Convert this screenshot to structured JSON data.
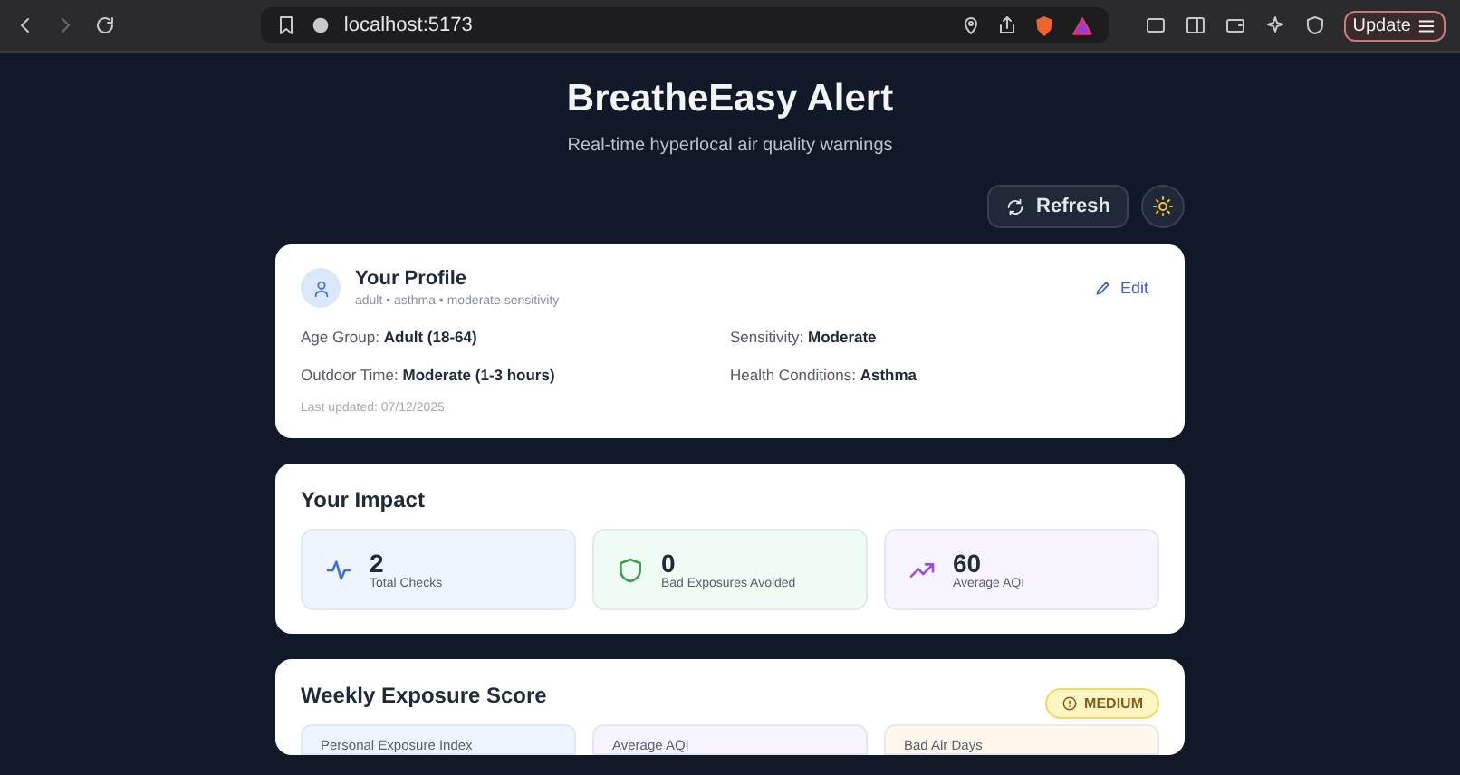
{
  "browser": {
    "url": "localhost:5173",
    "update_button": "Update"
  },
  "header": {
    "title": "BreatheEasy Alert",
    "subtitle": "Real-time hyperlocal air quality warnings",
    "refresh_button": "Refresh"
  },
  "profile": {
    "title": "Your Profile",
    "summary": "adult • asthma • moderate sensitivity",
    "edit_button": "Edit",
    "fields": [
      {
        "label": "Age Group:",
        "value": "Adult (18-64)"
      },
      {
        "label": "Sensitivity:",
        "value": "Moderate"
      },
      {
        "label": "Outdoor Time:",
        "value": "Moderate (1-3 hours)"
      },
      {
        "label": "Health Conditions:",
        "value": "Asthma"
      }
    ],
    "last_updated": "Last updated: 07/12/2025"
  },
  "impact": {
    "title": "Your Impact",
    "stats": [
      {
        "kind": "activity",
        "value": "2",
        "label": "Total Checks",
        "color": "#eff5ff"
      },
      {
        "kind": "shield",
        "value": "0",
        "label": "Bad Exposures Avoided",
        "color": "#effcf3"
      },
      {
        "kind": "trend",
        "value": "60",
        "label": "Average AQI",
        "color": "#f7f3ff"
      }
    ]
  },
  "weekly": {
    "title": "Weekly Exposure Score",
    "badge": "MEDIUM",
    "tiles": [
      {
        "label": "Personal Exposure Index",
        "color": "#eff5ff"
      },
      {
        "label": "Average AQI",
        "color": "#f7f3ff"
      },
      {
        "label": "Bad Air Days",
        "color": "#fff7ec"
      }
    ]
  }
}
